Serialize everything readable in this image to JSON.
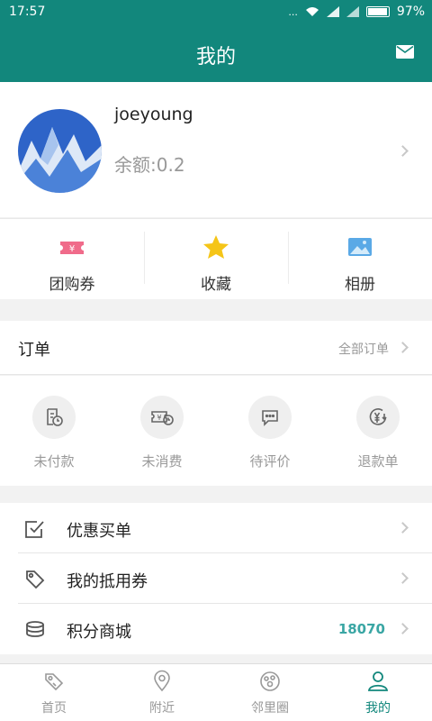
{
  "status_bar": {
    "time": "17:57",
    "dots": "...",
    "battery": "97%"
  },
  "header": {
    "title": "我的",
    "mail_icon": "mail-icon"
  },
  "profile": {
    "username": "joeyoung",
    "balance": "余额:0.2"
  },
  "quick_actions": [
    {
      "label": "团购券",
      "icon": "ticket-icon",
      "color": "#f06b8a"
    },
    {
      "label": "收藏",
      "icon": "star-icon",
      "color": "#f5c518"
    },
    {
      "label": "相册",
      "icon": "photo-icon",
      "color": "#5aa9e6"
    }
  ],
  "orders": {
    "title": "订单",
    "all_label": "全部订单",
    "statuses": [
      {
        "label": "未付款",
        "icon": "unpaid-icon"
      },
      {
        "label": "未消费",
        "icon": "unused-ticket-icon"
      },
      {
        "label": "待评价",
        "icon": "comment-icon"
      },
      {
        "label": "退款单",
        "icon": "refund-icon"
      }
    ]
  },
  "menu": [
    {
      "label": "优惠买单",
      "icon": "checkbox-icon",
      "value": ""
    },
    {
      "label": "我的抵用券",
      "icon": "tag-icon",
      "value": ""
    },
    {
      "label": "积分商城",
      "icon": "coins-icon",
      "value": "18070"
    }
  ],
  "tabs": [
    {
      "label": "首页",
      "icon": "home-tag-icon",
      "active": false
    },
    {
      "label": "附近",
      "icon": "location-pin-icon",
      "active": false
    },
    {
      "label": "邻里圈",
      "icon": "community-icon",
      "active": false
    },
    {
      "label": "我的",
      "icon": "person-icon",
      "active": true
    }
  ],
  "colors": {
    "brand": "#12877c",
    "accent_value": "#3aa6a4",
    "muted_text": "#999999"
  }
}
